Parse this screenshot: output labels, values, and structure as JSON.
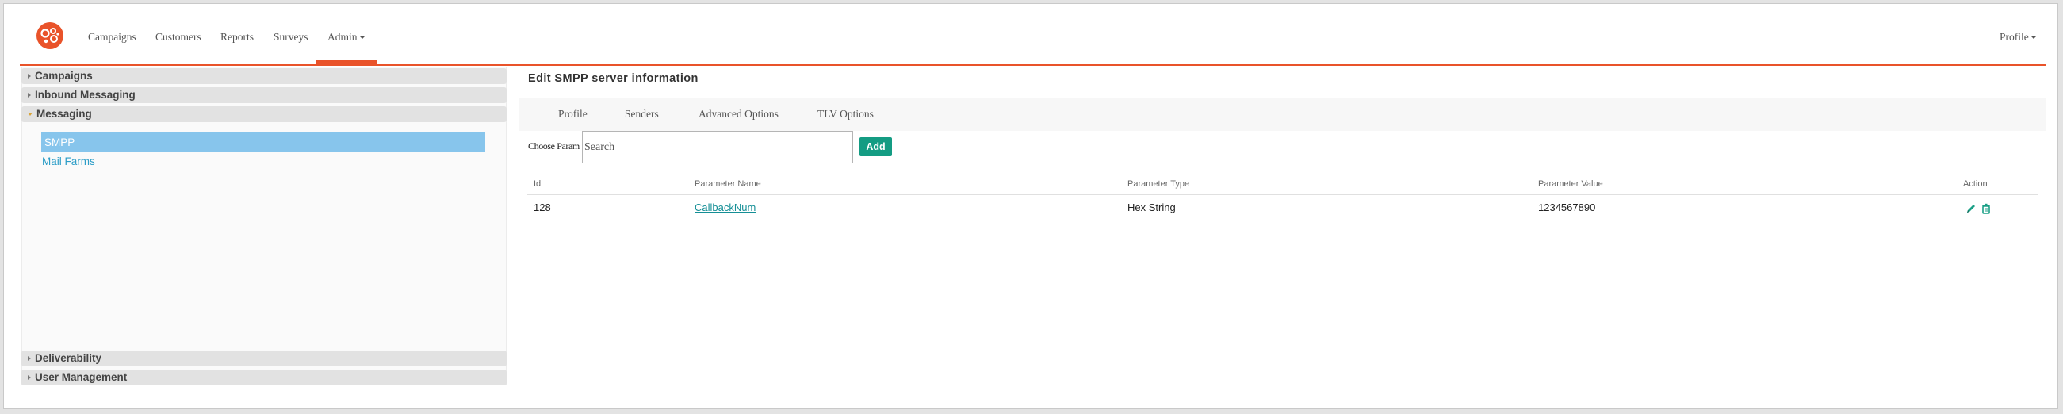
{
  "nav": {
    "items": [
      "Campaigns",
      "Customers",
      "Reports",
      "Surveys",
      "Admin"
    ],
    "active": "Admin",
    "profile": "Profile"
  },
  "sidebar": {
    "sections_top": [
      {
        "label": "Campaigns",
        "expanded": false
      },
      {
        "label": "Inbound Messaging",
        "expanded": false
      },
      {
        "label": "Messaging",
        "expanded": true
      }
    ],
    "messaging_items": [
      {
        "label": "SMPP",
        "active": true
      },
      {
        "label": "Mail Farms",
        "active": false
      }
    ],
    "sections_bottom": [
      {
        "label": "Deliverability",
        "expanded": false
      },
      {
        "label": "User Management",
        "expanded": false
      }
    ]
  },
  "main": {
    "title": "Edit SMPP server information",
    "tabs": [
      "Profile",
      "Senders",
      "Advanced Options",
      "TLV Options"
    ],
    "param_label": "Choose Param",
    "search_placeholder": "Search",
    "add_label": "Add",
    "table": {
      "headers": [
        "Id",
        "Parameter Name",
        "Parameter Type",
        "Parameter Value",
        "Action"
      ],
      "rows": [
        {
          "id": "128",
          "name": "CallbackNum",
          "type": "Hex String",
          "value": "1234567890"
        }
      ]
    }
  },
  "colors": {
    "brand": "#e9532a",
    "active_item": "#87c5ec",
    "link": "#2c9dc7",
    "add_button": "#149c83",
    "action_icons": "#1a9f86"
  },
  "icons": [
    "logo-icon",
    "caret-down-icon",
    "triangle-right-icon",
    "triangle-down-icon",
    "pencil-icon",
    "trash-icon"
  ]
}
